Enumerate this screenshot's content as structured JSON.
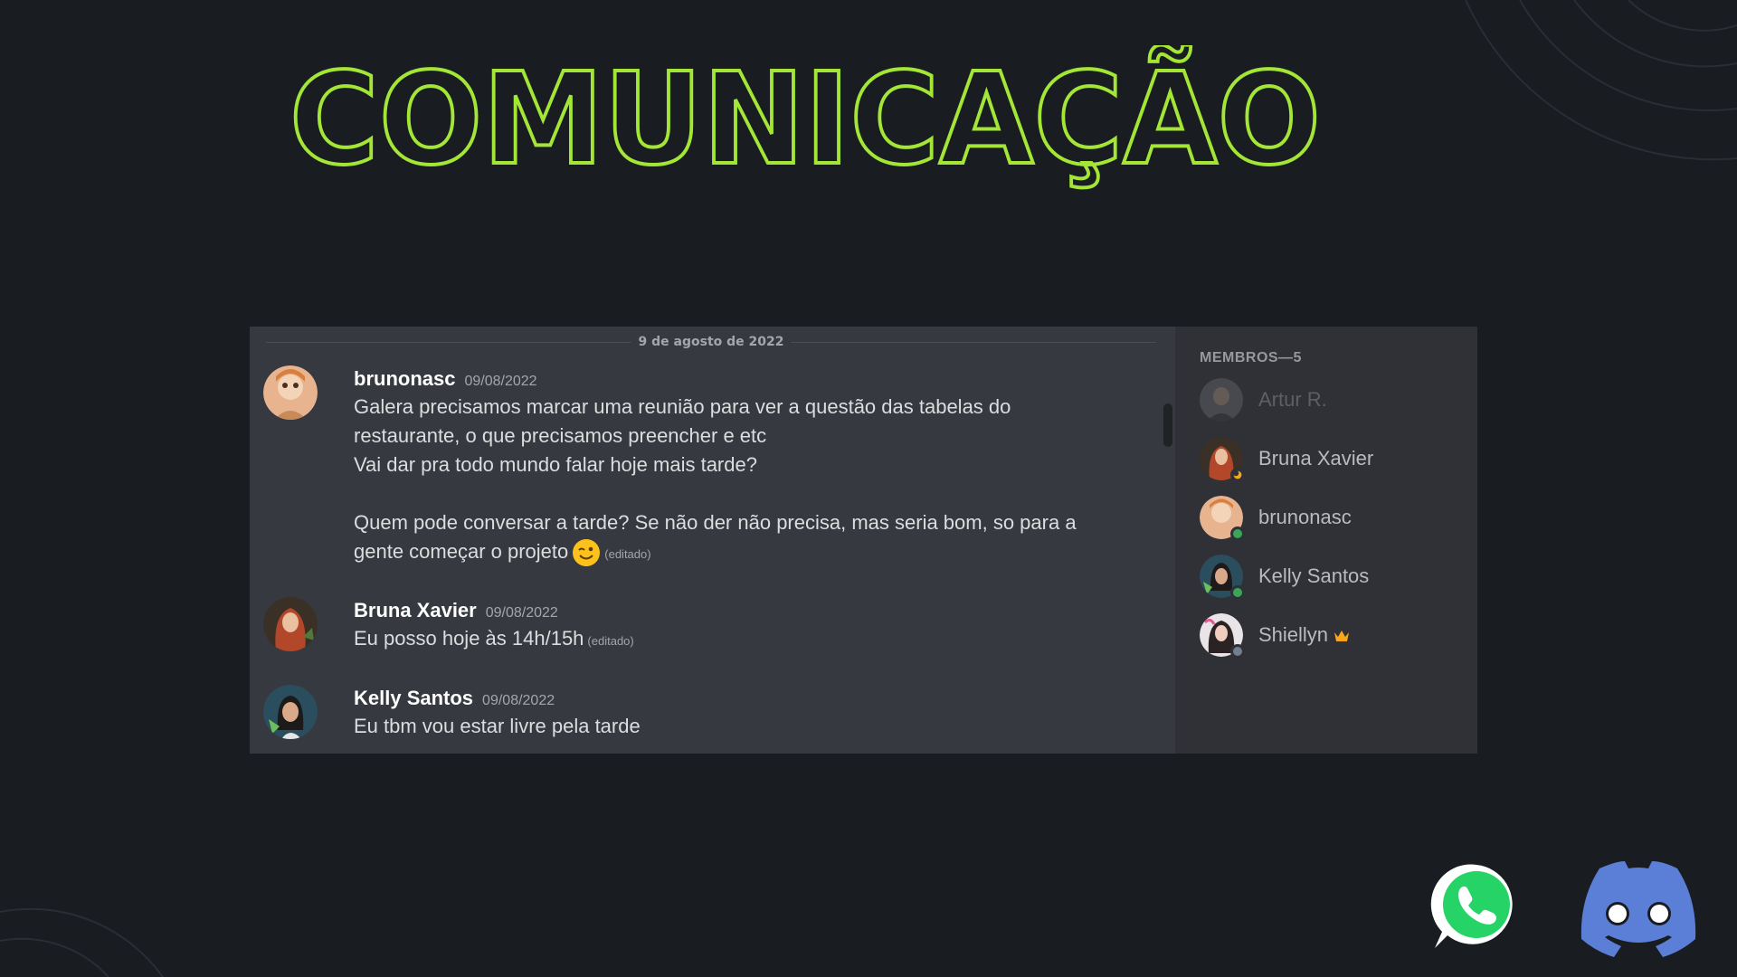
{
  "title": "COMUNICAÇÃO",
  "colors": {
    "background": "#191c21",
    "title_stroke": "#a3e635",
    "panel": "#36393f",
    "members_bg": "#2f3136",
    "online": "#3ba55c",
    "idle": "#faa81a",
    "offline": "#747f8d",
    "whatsapp": "#25d366",
    "discord": "#5b7fd6"
  },
  "chat": {
    "date_divider": "9 de agosto de 2022",
    "messages": [
      {
        "author": "brunonasc",
        "timestamp": "09/08/2022",
        "lines": [
          "Galera precisamos marcar uma reunião para ver a questão das tabelas do",
          "restaurante, o que precisamos preencher e etc",
          "Vai dar pra todo mundo falar hoje mais tarde?",
          "",
          "Quem pode conversar a tarde? Se não der não precisa, mas seria bom, so para a",
          "gente começar o projeto"
        ],
        "emoji": "winking-face",
        "edited": "(editado)"
      },
      {
        "author": "Bruna Xavier",
        "timestamp": "09/08/2022",
        "text": "Eu posso hoje às 14h/15h",
        "edited": "(editado)"
      },
      {
        "author": "Kelly Santos",
        "timestamp": "09/08/2022",
        "text": "Eu tbm vou estar livre pela tarde"
      }
    ]
  },
  "members": {
    "header": "MEMBROS—5",
    "list": [
      {
        "name": "Artur R.",
        "status": "offline"
      },
      {
        "name": "Bruna Xavier",
        "status": "idle"
      },
      {
        "name": "brunonasc",
        "status": "online"
      },
      {
        "name": "Kelly Santos",
        "status": "online"
      },
      {
        "name": "Shiellyn",
        "status": "offline",
        "badge": "crown-icon"
      }
    ]
  },
  "logos": [
    "whatsapp-logo",
    "discord-logo"
  ]
}
